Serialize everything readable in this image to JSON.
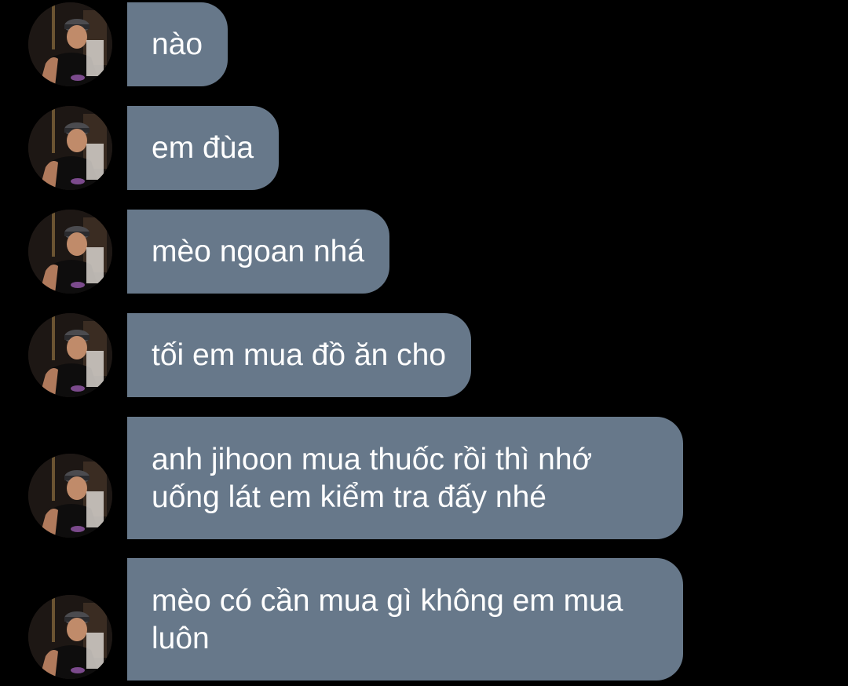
{
  "conversation": {
    "messages": [
      {
        "text": "nào"
      },
      {
        "text": "em đùa"
      },
      {
        "text": "mèo ngoan nhá"
      },
      {
        "text": "tối em mua đồ ăn cho"
      },
      {
        "text": "anh jihoon mua thuốc rồi thì nhớ\nuống lát em kiểm tra đấy nhé"
      },
      {
        "text": "mèo có cần mua gì không em mua\nluôn"
      }
    ]
  },
  "colors": {
    "background": "#000000",
    "bubble": "#67788a",
    "text": "#ffffff"
  },
  "icons": {
    "avatar": "profile-photo-avatar-icon"
  }
}
